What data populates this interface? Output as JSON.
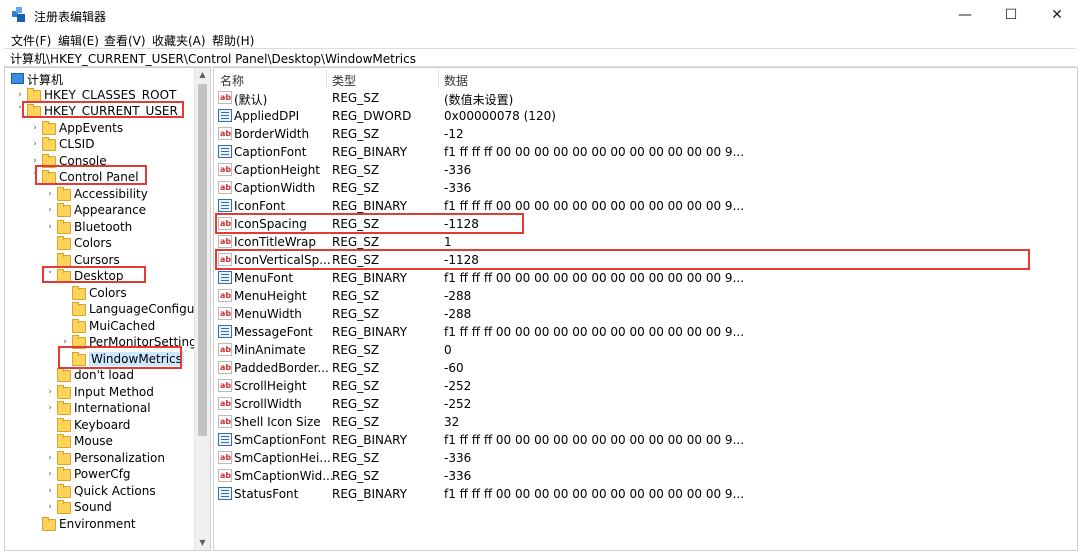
{
  "window": {
    "title": "注册表编辑器",
    "minimize": "—",
    "maximize": "☐",
    "close": "✕"
  },
  "menu": [
    "文件(F)",
    "编辑(E)",
    "查看(V)",
    "收藏夹(A)",
    "帮助(H)"
  ],
  "address": "计算机\\HKEY_CURRENT_USER\\Control Panel\\Desktop\\WindowMetrics",
  "columns": {
    "name": "名称",
    "type": "类型",
    "data": "数据"
  },
  "tree": [
    {
      "label": "计算机",
      "level": 0,
      "expander": "",
      "icon": "computer-icon"
    },
    {
      "label": "HKEY_CLASSES_ROOT",
      "level": 1,
      "expander": "›"
    },
    {
      "label": "HKEY_CURRENT_USER",
      "level": 1,
      "expander": "˅"
    },
    {
      "label": "AppEvents",
      "level": 2,
      "expander": "›"
    },
    {
      "label": "CLSID",
      "level": 2,
      "expander": "›"
    },
    {
      "label": "Console",
      "level": 2,
      "expander": "›"
    },
    {
      "label": "Control Panel",
      "level": 2,
      "expander": "˅"
    },
    {
      "label": "Accessibility",
      "level": 3,
      "expander": "›"
    },
    {
      "label": "Appearance",
      "level": 3,
      "expander": "›"
    },
    {
      "label": "Bluetooth",
      "level": 3,
      "expander": "›"
    },
    {
      "label": "Colors",
      "level": 3,
      "expander": ""
    },
    {
      "label": "Cursors",
      "level": 3,
      "expander": ""
    },
    {
      "label": "Desktop",
      "level": 3,
      "expander": "˅"
    },
    {
      "label": "Colors",
      "level": 4,
      "expander": ""
    },
    {
      "label": "LanguageConfigura",
      "level": 4,
      "expander": ""
    },
    {
      "label": "MuiCached",
      "level": 4,
      "expander": ""
    },
    {
      "label": "PerMonitorSettings",
      "level": 4,
      "expander": "›"
    },
    {
      "label": "WindowMetrics",
      "level": 4,
      "expander": "",
      "selected": true
    },
    {
      "label": "don't load",
      "level": 3,
      "expander": ""
    },
    {
      "label": "Input Method",
      "level": 3,
      "expander": "›"
    },
    {
      "label": "International",
      "level": 3,
      "expander": "›"
    },
    {
      "label": "Keyboard",
      "level": 3,
      "expander": ""
    },
    {
      "label": "Mouse",
      "level": 3,
      "expander": ""
    },
    {
      "label": "Personalization",
      "level": 3,
      "expander": "›"
    },
    {
      "label": "PowerCfg",
      "level": 3,
      "expander": "›"
    },
    {
      "label": "Quick Actions",
      "level": 3,
      "expander": "›"
    },
    {
      "label": "Sound",
      "level": 3,
      "expander": "›"
    },
    {
      "label": "Environment",
      "level": 2,
      "expander": ""
    }
  ],
  "values": [
    {
      "name": "(默认)",
      "type": "REG_SZ",
      "data": "(数值未设置)",
      "icon": "sz"
    },
    {
      "name": "AppliedDPI",
      "type": "REG_DWORD",
      "data": "0x00000078 (120)",
      "icon": "bin"
    },
    {
      "name": "BorderWidth",
      "type": "REG_SZ",
      "data": "-12",
      "icon": "sz"
    },
    {
      "name": "CaptionFont",
      "type": "REG_BINARY",
      "data": "f1 ff ff ff 00 00 00 00 00 00 00 00 00 00 00 00 9...",
      "icon": "bin"
    },
    {
      "name": "CaptionHeight",
      "type": "REG_SZ",
      "data": "-336",
      "icon": "sz"
    },
    {
      "name": "CaptionWidth",
      "type": "REG_SZ",
      "data": "-336",
      "icon": "sz"
    },
    {
      "name": "IconFont",
      "type": "REG_BINARY",
      "data": "f1 ff ff ff 00 00 00 00 00 00 00 00 00 00 00 00 9...",
      "icon": "bin"
    },
    {
      "name": "IconSpacing",
      "type": "REG_SZ",
      "data": "-1128",
      "icon": "sz"
    },
    {
      "name": "IconTitleWrap",
      "type": "REG_SZ",
      "data": "1",
      "icon": "sz"
    },
    {
      "name": "IconVerticalSp...",
      "type": "REG_SZ",
      "data": "-1128",
      "icon": "sz"
    },
    {
      "name": "MenuFont",
      "type": "REG_BINARY",
      "data": "f1 ff ff ff 00 00 00 00 00 00 00 00 00 00 00 00 9...",
      "icon": "bin"
    },
    {
      "name": "MenuHeight",
      "type": "REG_SZ",
      "data": "-288",
      "icon": "sz"
    },
    {
      "name": "MenuWidth",
      "type": "REG_SZ",
      "data": "-288",
      "icon": "sz"
    },
    {
      "name": "MessageFont",
      "type": "REG_BINARY",
      "data": "f1 ff ff ff 00 00 00 00 00 00 00 00 00 00 00 00 9...",
      "icon": "bin"
    },
    {
      "name": "MinAnimate",
      "type": "REG_SZ",
      "data": "0",
      "icon": "sz"
    },
    {
      "name": "PaddedBorder...",
      "type": "REG_SZ",
      "data": "-60",
      "icon": "sz"
    },
    {
      "name": "ScrollHeight",
      "type": "REG_SZ",
      "data": "-252",
      "icon": "sz"
    },
    {
      "name": "ScrollWidth",
      "type": "REG_SZ",
      "data": "-252",
      "icon": "sz"
    },
    {
      "name": "Shell Icon Size",
      "type": "REG_SZ",
      "data": "32",
      "icon": "sz"
    },
    {
      "name": "SmCaptionFont",
      "type": "REG_BINARY",
      "data": "f1 ff ff ff 00 00 00 00 00 00 00 00 00 00 00 00 9...",
      "icon": "bin"
    },
    {
      "name": "SmCaptionHei...",
      "type": "REG_SZ",
      "data": "-336",
      "icon": "sz"
    },
    {
      "name": "SmCaptionWid...",
      "type": "REG_SZ",
      "data": "-336",
      "icon": "sz"
    },
    {
      "name": "StatusFont",
      "type": "REG_BINARY",
      "data": "f1 ff ff ff 00 00 00 00 00 00 00 00 00 00 00 00 9...",
      "icon": "bin"
    }
  ],
  "colors": {
    "highlight_box": "#e53935",
    "selection": "#cce8ff",
    "folder": "#ffd25a"
  }
}
